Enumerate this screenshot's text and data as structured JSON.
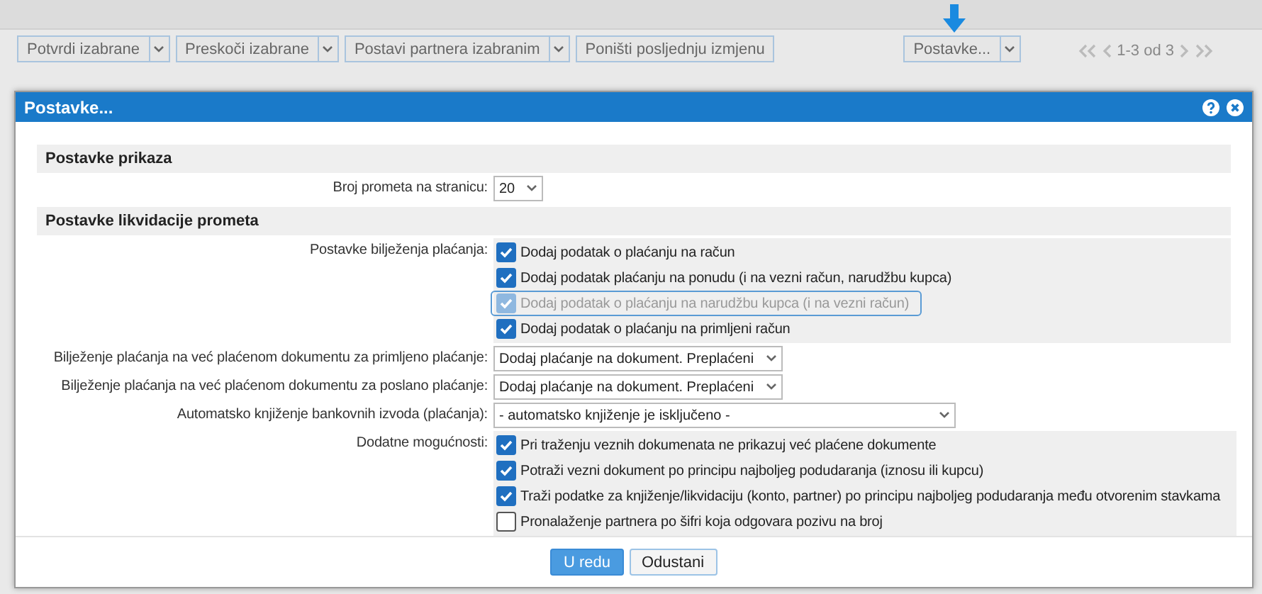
{
  "toolbar": {
    "buttons": [
      {
        "label": "Potvrdi izabrane",
        "dropdown": true
      },
      {
        "label": "Preskoči izabrane",
        "dropdown": true
      },
      {
        "label": "Postavi partnera izabranim",
        "dropdown": true
      },
      {
        "label": "Poništi posljednju izmjenu",
        "dropdown": false
      }
    ],
    "settings_button": {
      "label": "Postavke...",
      "dropdown": true
    },
    "pagination": {
      "text": "1-3 od 3"
    }
  },
  "dialog": {
    "title": "Postavke...",
    "sections": [
      {
        "title": "Postavke prikaza",
        "rows": [
          {
            "kind": "select",
            "label": "Broj prometa na stranicu:",
            "value": "20",
            "wide": false
          }
        ]
      },
      {
        "title": "Postavke likvidacije prometa",
        "rows": [
          {
            "kind": "checks",
            "label": "Postavke bilježenja plaćanja:",
            "items": [
              {
                "label": "Dodaj podatak o plaćanju na račun",
                "checked": true,
                "disabled": false,
                "focused": false
              },
              {
                "label": "Dodaj podatak plaćanju na ponudu (i na vezni račun, narudžbu kupca)",
                "checked": true,
                "disabled": false,
                "focused": false
              },
              {
                "label": "Dodaj podatak o plaćanju na narudžbu kupca (i na vezni račun)",
                "checked": true,
                "disabled": true,
                "focused": true
              },
              {
                "label": "Dodaj podatak o plaćanju na primljeni račun",
                "checked": true,
                "disabled": false,
                "focused": false
              }
            ]
          },
          {
            "kind": "select",
            "label": "Bilježenje plaćanja na već plaćenom dokumentu za primljeno plaćanje:",
            "value": "Dodaj plaćanje na dokument. Preplaćeni",
            "wide": false
          },
          {
            "kind": "select",
            "label": "Bilježenje plaćanja na već plaćenom dokumentu za poslano plaćanje:",
            "value": "Dodaj plaćanje na dokument. Preplaćeni",
            "wide": false
          },
          {
            "kind": "select",
            "label": "Automatsko knjiženje bankovnih izvoda (plaćanja):",
            "value": "- automatsko knjiženje je isključeno -",
            "wide": true
          },
          {
            "kind": "checks",
            "label": "Dodatne mogućnosti:",
            "items": [
              {
                "label": "Pri traženju veznih dokumenata ne prikazuj već plaćene dokumente",
                "checked": true,
                "disabled": false,
                "focused": false
              },
              {
                "label": "Potraži vezni dokument po principu najboljeg podudaranja (iznosu ili kupcu)",
                "checked": true,
                "disabled": false,
                "focused": false
              },
              {
                "label": "Traži podatke za knjiženje/likvidaciju (konto, partner) po principu najboljeg podudaranja među otvorenim stavkama",
                "checked": true,
                "disabled": false,
                "focused": false
              },
              {
                "label": "Pronalaženje partnera po šifri koja odgovara pozivu na broj",
                "checked": false,
                "disabled": false,
                "focused": false
              }
            ]
          }
        ]
      }
    ],
    "buttons": [
      {
        "label": "U redu",
        "primary": true
      },
      {
        "label": "Odustani",
        "primary": false
      }
    ]
  }
}
